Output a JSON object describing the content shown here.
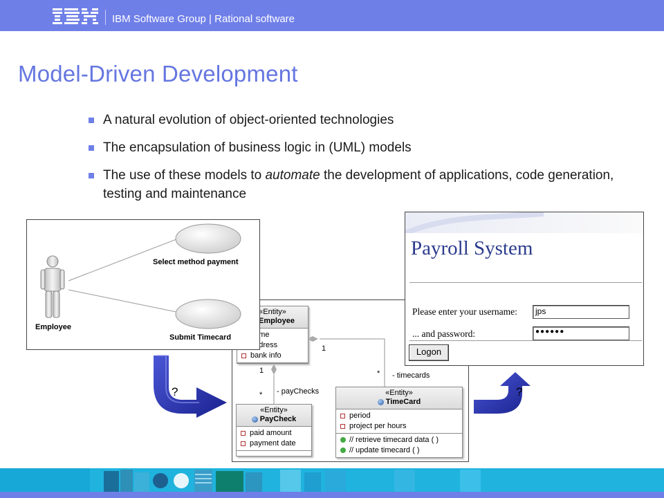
{
  "header": {
    "logo_text": "IBM",
    "group": "IBM Software Group | Rational software"
  },
  "slide": {
    "title": "Model-Driven Development",
    "bullets": [
      "A natural evolution of object-oriented technologies",
      "The encapsulation of business logic in (UML) models",
      "The use of these models to automate the development of applications, code generation, testing and maintenance"
    ]
  },
  "use_case": {
    "actor": "Employee",
    "case1": "Select method payment",
    "case2": "Submit Timecard"
  },
  "class_diagram": {
    "employee": {
      "stereotype": "«Entity»",
      "name": "Employee",
      "attributes": [
        "name",
        "address",
        "bank info"
      ]
    },
    "paycheck": {
      "stereotype": "«Entity»",
      "name": "PayCheck",
      "attributes": [
        "paid amount",
        "payment date"
      ]
    },
    "timecard": {
      "stereotype": "«Entity»",
      "name": "TimeCard",
      "attributes": [
        "period",
        "project per hours"
      ],
      "operations": [
        "// retrieve timecard data ( )",
        "// update timecard ( )"
      ]
    },
    "labels": {
      "mult_emp_tc": "1",
      "mult_tc": "*",
      "timecards": "- timecards",
      "mult_emp_pc": "1",
      "mult_pc": "*",
      "paychecks": "- payChecks"
    }
  },
  "payroll": {
    "title": "Payroll System",
    "username_label": "Please enter your username:",
    "username_value": "jps",
    "password_label": "... and password:",
    "password_mask": "●●●●●●",
    "logon_label": "Logon"
  },
  "arrows": {
    "left_q": "?",
    "right_q": "?"
  },
  "colors": {
    "brand": "#6f7fe8",
    "title": "#6576e0",
    "arrow": "#2a34b8",
    "footer": "#1fb3de"
  }
}
